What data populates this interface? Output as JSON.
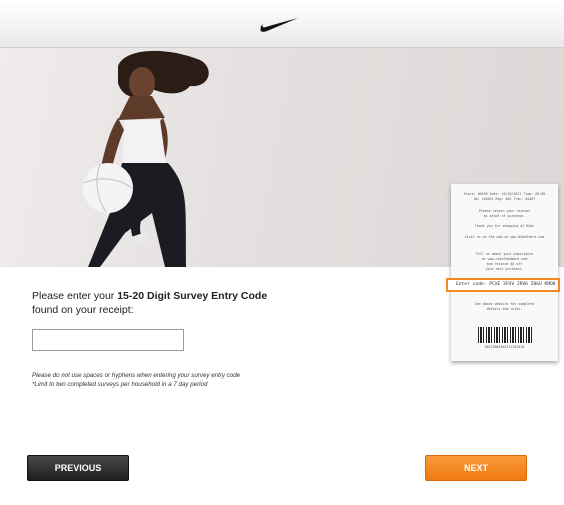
{
  "header": {
    "logo_icon": "nike-swoosh-icon"
  },
  "prompt": {
    "text_before": "Please enter your ",
    "text_bold": "15-20 Digit Survey Entry Code",
    "text_after": "found on your receipt:"
  },
  "code_input": {
    "value": "",
    "placeholder": ""
  },
  "notes": {
    "line1": "Please do not use spaces or hyphens when entering your survey entry code",
    "line2": "*Limit to two completed surveys per household in a 7 day period"
  },
  "receipt": {
    "header1": "Store: 00109  Date: 10/16/2011  Time: 09:00",
    "header2": "Op: 105021    Reg: 001    Tran: 04487",
    "line1": "Please retain your receipt",
    "line2": "as proof of purchase.",
    "line3": "Thank you for shopping at Nike",
    "line4": "Visit us on the web at www.NikeStore.com",
    "line5": "Tell us about your experience",
    "line6": "at www.nikefeedback.com",
    "line7": "and receive $5 off",
    "line8": "your next purchase.",
    "highlight": "Enter code: PCXE 3FUV 2RV6 Z0GU KMO6",
    "line9": "See above website for complete",
    "line10": "details and rules.",
    "barcode_number": "00123005448712101010"
  },
  "buttons": {
    "previous": "PREVIOUS",
    "next": "NEXT"
  },
  "colors": {
    "accent": "#f28a1e",
    "dark_button": "#2a2a2a",
    "next_button": "#f5811b"
  }
}
